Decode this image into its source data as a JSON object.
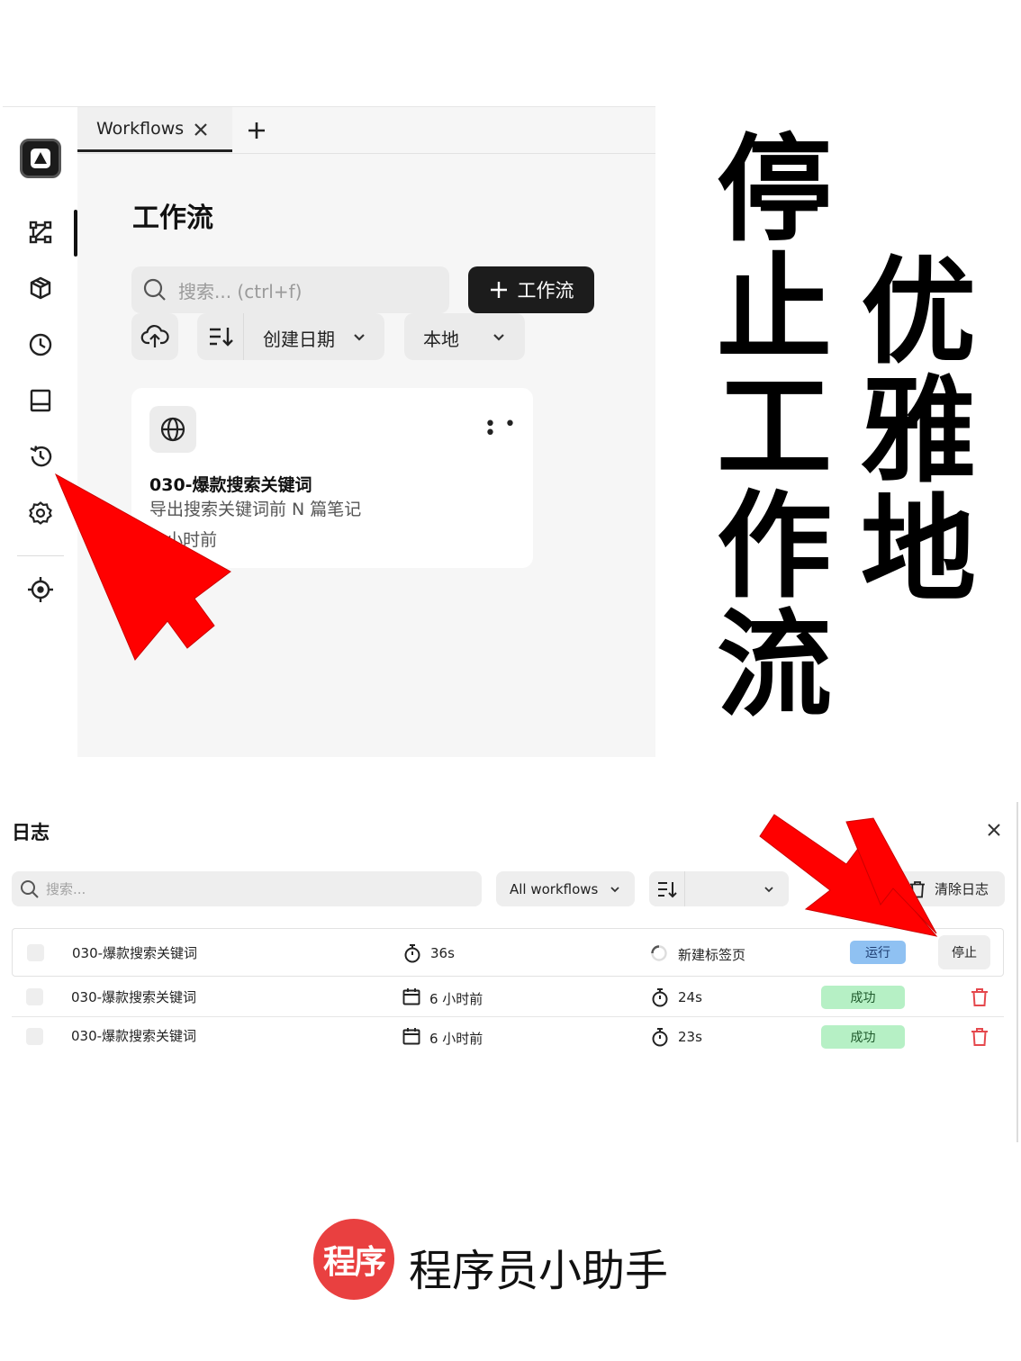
{
  "workflows_app": {
    "tab": {
      "label": "Workflows"
    },
    "page_title": "工作流",
    "search": {
      "placeholder": "搜索... (ctrl+f)"
    },
    "new_button": {
      "label": "工作流"
    },
    "sort": {
      "label": "创建日期"
    },
    "location": {
      "label": "本地"
    },
    "sidebar_icons": [
      "workflow-icon",
      "package-icon",
      "clock-icon",
      "storage-icon",
      "history-icon",
      "settings-icon",
      "crosshair-icon"
    ],
    "card": {
      "title": "030-爆款搜索关键词",
      "description": "导出搜索关键词前 N 篇笔记",
      "time": "6 小时前"
    }
  },
  "headline": {
    "column1": [
      "停",
      "止",
      "工",
      "作",
      "流"
    ],
    "column2": [
      "优",
      "雅",
      "地"
    ]
  },
  "logs": {
    "title": "日志",
    "search": {
      "placeholder": "搜索..."
    },
    "filter": {
      "label": "All workflows"
    },
    "clear": {
      "label": "清除日志"
    },
    "rows": [
      {
        "name": "030-爆款搜索关键词",
        "duration": "36s",
        "tab": "新建标签页",
        "status": "运行",
        "action": "停止"
      },
      {
        "name": "030-爆款搜索关键词",
        "time": "6 小时前",
        "duration": "24s",
        "status": "成功"
      },
      {
        "name": "030-爆款搜索关键词",
        "time": "6 小时前",
        "duration": "23s",
        "status": "成功"
      }
    ]
  },
  "brand": {
    "badge": "程序",
    "name": "程序员小助手"
  },
  "colors": {
    "arrow": "#ff0000",
    "running_badge": "#8fc1f2",
    "success_badge": "#b6f0c5",
    "delete_icon": "#e5484d",
    "brand_badge": "#e94040"
  }
}
